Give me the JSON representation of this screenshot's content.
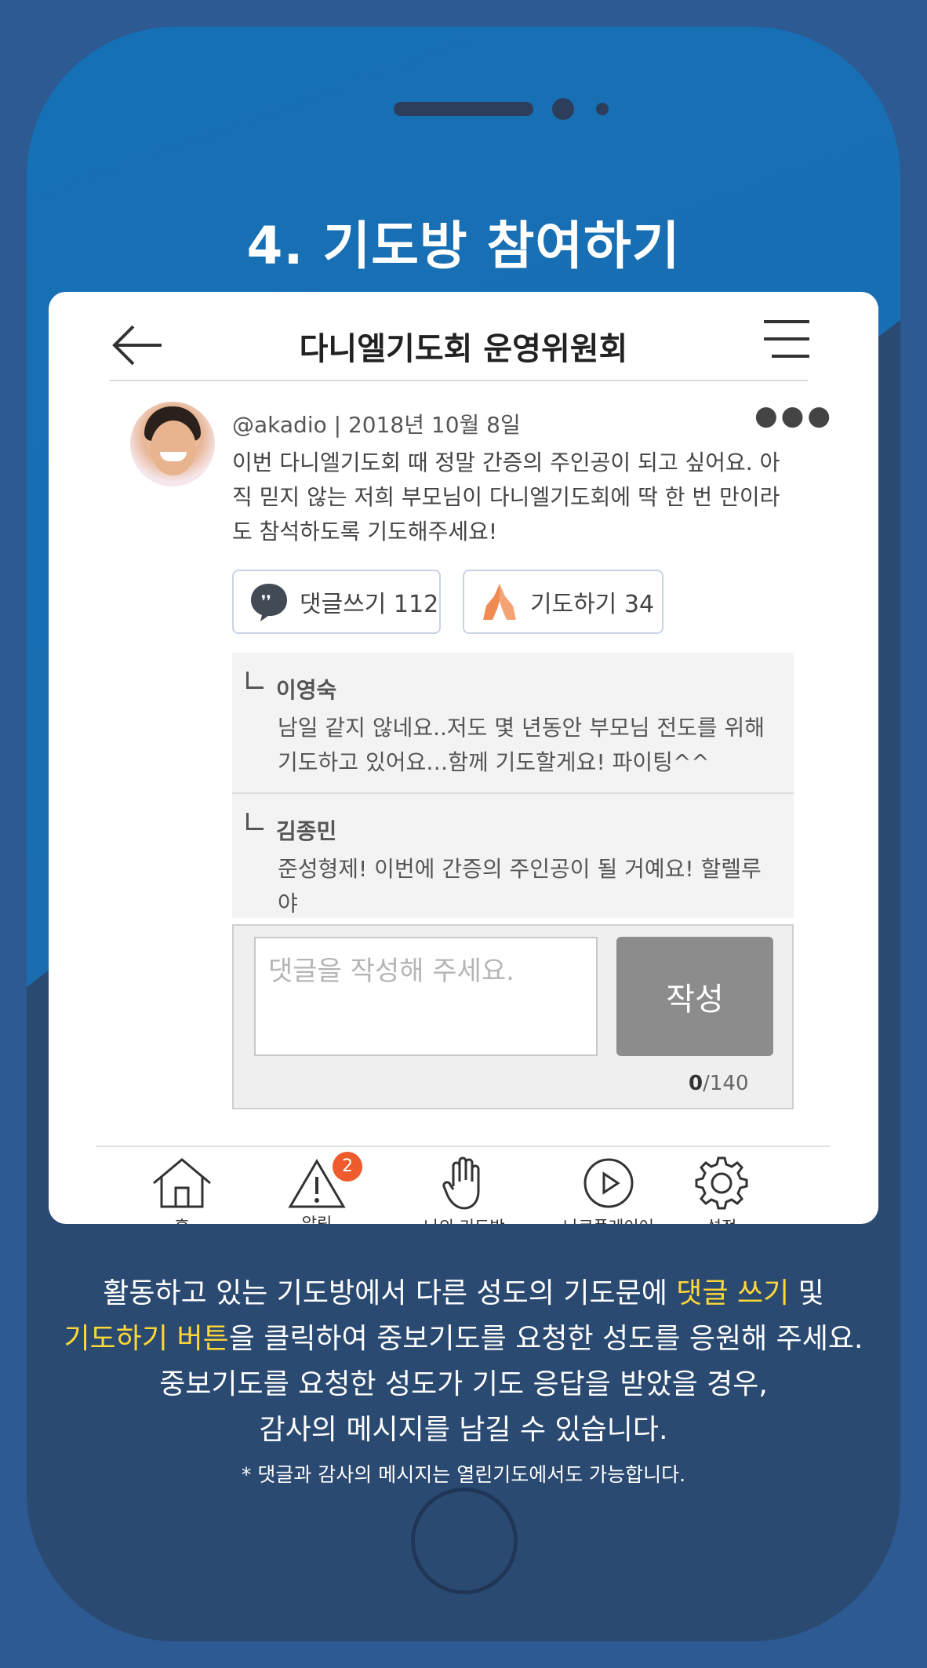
{
  "page": {
    "title": "4. 기도방 참여하기"
  },
  "app": {
    "header_title": "다니엘기도회 운영위원회"
  },
  "post": {
    "author": "@akadio",
    "date": "2018년 10월 8일",
    "meta": "@akadio | 2018년 10월 8일",
    "body": "이번 다니엘기도회 때 정말 간증의 주인공이 되고 싶어요. 아직 믿지 않는 저희 부모님이 다니엘기도회에 딱 한 번 만이라도 참석하도록 기도해주세요!",
    "comment_button": "댓글쓰기 112",
    "pray_button": "기도하기 34"
  },
  "replies": [
    {
      "name": "이영숙",
      "text": "남일 같지 않네요..저도 몇 년동안 부모님 전도를 위해 기도하고 있어요…함께 기도할게요! 파이팅^^"
    },
    {
      "name": "김종민",
      "text": "준성형제! 이번에 간증의 주인공이 될 거예요! 할렐루야"
    }
  ],
  "compose": {
    "placeholder": "댓글을 작성해 주세요.",
    "submit_label": "작성",
    "count": "0",
    "max": "/140"
  },
  "tabs": [
    {
      "label": "홈",
      "icon": "home-icon"
    },
    {
      "label": "알림",
      "icon": "alert-icon",
      "badge": "2"
    },
    {
      "label": "나의 기도방",
      "icon": "praying-hand-icon"
    },
    {
      "label": "나로플레이어",
      "icon": "play-icon"
    },
    {
      "label": "설정",
      "icon": "gear-icon"
    }
  ],
  "caption": {
    "line1_a": "활동하고 있는 기도방에서 다른 성도의 기도문에 ",
    "line1_hl": "댓글 쓰기",
    "line1_b": " 및",
    "line2_hl": "기도하기 버튼",
    "line2_b": "을 클릭하여 중보기도를 요청한 성도를 응원해 주세요.",
    "line3": "중보기도를 요청한 성도가 기도 응답을 받았을 경우,",
    "line4": "감사의 메시지를 남길 수 있습니다.",
    "note": "* 댓글과 감사의 메시지는 열린기도에서도 가능합니다."
  },
  "colors": {
    "phone_blue": "#1670b6",
    "phone_dark": "#2b4a72",
    "highlight": "#ffd836",
    "badge": "#ee5b2c",
    "pray_icon": "#f08a52"
  }
}
